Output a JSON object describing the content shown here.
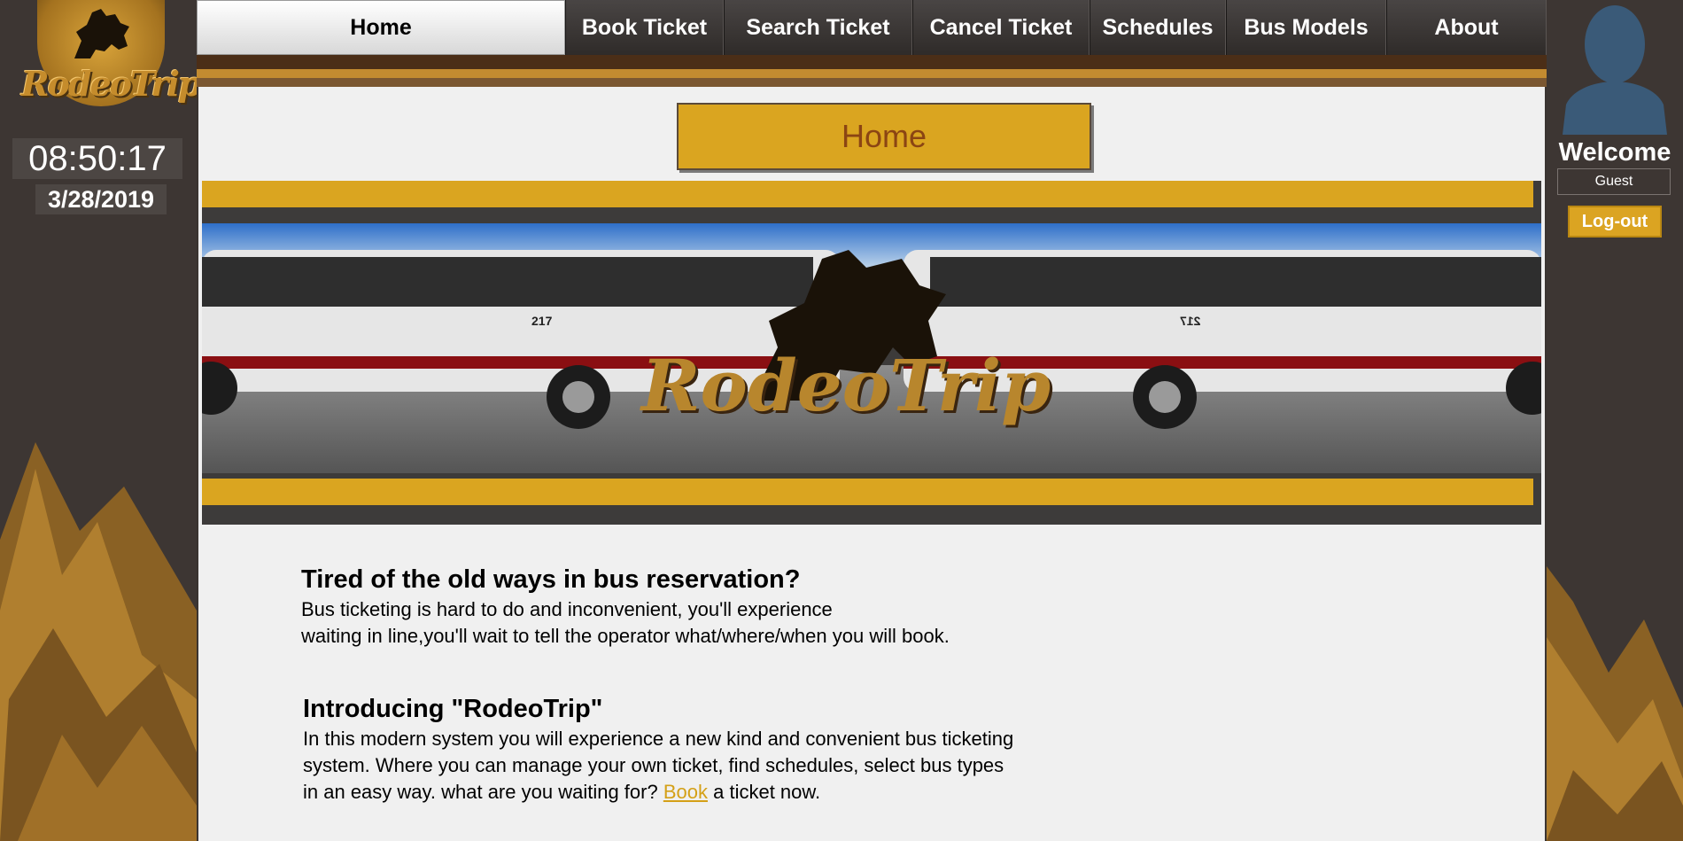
{
  "logo": {
    "text": "RodeoTrip"
  },
  "clock": {
    "time": "08:50:17",
    "date": "3/28/2019"
  },
  "nav": {
    "items": [
      {
        "label": "Home",
        "active": true
      },
      {
        "label": "Book Ticket"
      },
      {
        "label": "Search Ticket"
      },
      {
        "label": "Cancel Ticket"
      },
      {
        "label": "Schedules"
      },
      {
        "label": "Bus Models"
      },
      {
        "label": "About"
      }
    ]
  },
  "user": {
    "welcome": "Welcome",
    "name": "Guest",
    "logout_label": "Log-out"
  },
  "page": {
    "title": "Home"
  },
  "banner": {
    "brand_text": "RodeoTrip",
    "bus_number": "217"
  },
  "content": {
    "heading1": "Tired of the old ways in bus reservation?",
    "para1_line1": "Bus ticketing is hard to do and inconvenient, you'll experience",
    "para1_line2": "waiting in line,you'll wait to tell the operator what/where/when you will book.",
    "heading2": "Introducing \"RodeoTrip\"",
    "para2_line1": "In this modern system you will experience a new kind and convenient bus ticketing",
    "para2_line2": "system. Where you can manage your own ticket, find schedules, select bus types",
    "para2_line3_start": "in an easy way. what are you waiting for?",
    "para2_link": "Book",
    "para2_line3_end": "a ticket now."
  },
  "colors": {
    "gold": "#daa520",
    "dark": "#3d3633",
    "title_text": "#8b4513"
  }
}
